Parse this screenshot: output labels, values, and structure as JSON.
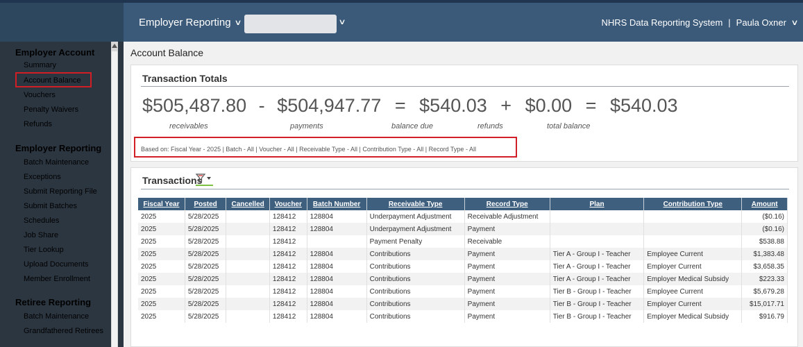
{
  "header": {
    "module_dropdown": "Employer Reporting",
    "system_name": "NHRS Data Reporting System",
    "separator": "|",
    "user_name": "Paula Oxner"
  },
  "sidebar": {
    "sections": [
      {
        "title": "Employer Account",
        "items": [
          "Summary",
          "Account Balance",
          "Vouchers",
          "Penalty Waivers",
          "Refunds"
        ]
      },
      {
        "title": "Employer Reporting",
        "items": [
          "Batch Maintenance",
          "Exceptions",
          "Submit Reporting File",
          "Submit Batches",
          "Schedules",
          "Job Share",
          "Tier Lookup",
          "Upload Documents",
          "Member Enrollment"
        ]
      },
      {
        "title": "Retiree Reporting",
        "items": [
          "Batch Maintenance",
          "Grandfathered Retirees"
        ]
      }
    ],
    "highlighted_item": "Account Balance"
  },
  "page": {
    "title": "Account Balance"
  },
  "totals": {
    "title": "Transaction Totals",
    "receivables": "$505,487.80",
    "receivables_label": "receivables",
    "minus": "-",
    "payments": "$504,947.77",
    "payments_label": "payments",
    "equals1": "=",
    "balance_due": "$540.03",
    "balance_due_label": "balance due",
    "plus": "+",
    "refunds": "$0.00",
    "refunds_label": "refunds",
    "equals2": "=",
    "total_balance": "$540.03",
    "total_balance_label": "total balance",
    "based_on": "Based on: Fiscal Year - 2025 | Batch - All | Voucher - All | Receivable Type - All | Contribution Type - All | Record Type - All"
  },
  "transactions": {
    "title": "Transactions",
    "filter_icon": "filter-icon",
    "columns": [
      "Fiscal Year",
      "Posted",
      "Cancelled",
      "Voucher",
      "Batch Number",
      "Receivable Type",
      "Record Type",
      "Plan",
      "Contribution Type",
      "Amount"
    ],
    "rows": [
      [
        "2025",
        "5/28/2025",
        "",
        "128412",
        "128804",
        "Underpayment Adjustment",
        "Receivable Adjustment",
        "",
        "",
        "($0.16)"
      ],
      [
        "2025",
        "5/28/2025",
        "",
        "128412",
        "128804",
        "Underpayment Adjustment",
        "Payment",
        "",
        "",
        "($0.16)"
      ],
      [
        "2025",
        "5/28/2025",
        "",
        "128412",
        "",
        "Payment Penalty",
        "Receivable",
        "",
        "",
        "$538.88"
      ],
      [
        "2025",
        "5/28/2025",
        "",
        "128412",
        "128804",
        "Contributions",
        "Payment",
        "Tier A - Group I - Teacher",
        "Employee Current",
        "$1,383.48"
      ],
      [
        "2025",
        "5/28/2025",
        "",
        "128412",
        "128804",
        "Contributions",
        "Payment",
        "Tier A - Group I - Teacher",
        "Employer Current",
        "$3,658.35"
      ],
      [
        "2025",
        "5/28/2025",
        "",
        "128412",
        "128804",
        "Contributions",
        "Payment",
        "Tier A - Group I - Teacher",
        "Employer Medical Subsidy",
        "$223.33"
      ],
      [
        "2025",
        "5/28/2025",
        "",
        "128412",
        "128804",
        "Contributions",
        "Payment",
        "Tier B - Group I - Teacher",
        "Employee Current",
        "$5,679.28"
      ],
      [
        "2025",
        "5/28/2025",
        "",
        "128412",
        "128804",
        "Contributions",
        "Payment",
        "Tier B - Group I - Teacher",
        "Employer Current",
        "$15,017.71"
      ],
      [
        "2025",
        "5/28/2025",
        "",
        "128412",
        "128804",
        "Contributions",
        "Payment",
        "Tier B - Group I - Teacher",
        "Employer Medical Subsidy",
        "$916.79"
      ]
    ]
  },
  "colors": {
    "topbar": "#3b5a7a",
    "sidebar": "#2c3641",
    "table_header": "#3f5f7f",
    "highlight_border": "#d11f25",
    "filter_underline": "#7cc142"
  }
}
